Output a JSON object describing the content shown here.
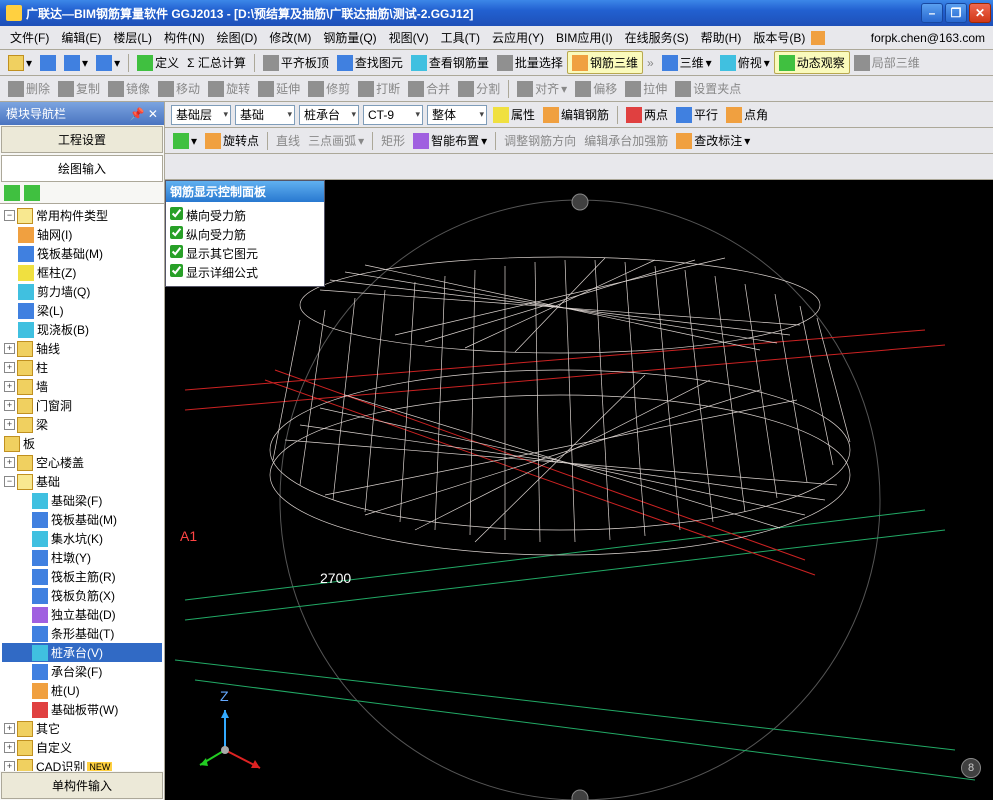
{
  "title": "广联达—BIM钢筋算量软件 GGJ2013 - [D:\\预结算及抽筋\\广联达抽筋\\测试-2.GGJ12]",
  "winbtns": {
    "min": "–",
    "max": "❐",
    "close": "✕"
  },
  "menu": [
    "文件(F)",
    "编辑(E)",
    "楼层(L)",
    "构件(N)",
    "绘图(D)",
    "修改(M)",
    "钢筋量(Q)",
    "视图(V)",
    "工具(T)",
    "云应用(Y)",
    "BIM应用(I)",
    "在线服务(S)",
    "帮助(H)",
    "版本号(B)"
  ],
  "email": "forpk.chen@163.com",
  "tb1": {
    "def": "定义",
    "sum": "Σ 汇总计算",
    "flat": "平齐板顶",
    "find": "查找图元",
    "view": "查看钢筋量",
    "batch": "批量选择",
    "rebar3d": "钢筋三维",
    "sw": "三维",
    "persp": "俯视",
    "dyn": "动态观察",
    "local": "局部三维"
  },
  "tb2": {
    "del": "删除",
    "copy": "复制",
    "mir": "镜像",
    "mov": "移动",
    "rot": "旋转",
    "ext": "延伸",
    "trim": "修剪",
    "brk": "打断",
    "mrg": "合并",
    "spl": "分割",
    "ali": "对齐",
    "off": "偏移",
    "str": "拉伸",
    "grip": "设置夹点"
  },
  "tb3": {
    "floor": "基础层",
    "fam": "基础",
    "type": "桩承台",
    "code": "CT-9",
    "whole": "整体",
    "attr": "属性",
    "editrebar": "编辑钢筋"
  },
  "tb4": {
    "pt2": "两点",
    "para": "平行",
    "ang": "点角",
    "rotpt": "旋转点",
    "line": "直线",
    "arc3": "三点画弧",
    "rect": "矩形",
    "smart": "智能布置",
    "adjust": "调整钢筋方向",
    "editpc": "编辑承台加强筋",
    "note": "查改标注"
  },
  "side": {
    "title": "模块导航栏",
    "tab1": "工程设置",
    "tab2": "绘图输入",
    "tree": {
      "n1": "常用构件类型",
      "n1a": "轴网(I)",
      "n1b": "筏板基础(M)",
      "n1c": "框柱(Z)",
      "n1d": "剪力墙(Q)",
      "n1e": "梁(L)",
      "n1f": "现浇板(B)",
      "n2": "轴线",
      "n3": "柱",
      "n4": "墙",
      "n5": "门窗洞",
      "n6": "梁",
      "n7": "板",
      "n8": "空心楼盖",
      "n9": "基础",
      "n9a": "基础梁(F)",
      "n9b": "筏板基础(M)",
      "n9c": "集水坑(K)",
      "n9d": "柱墩(Y)",
      "n9e": "筏板主筋(R)",
      "n9f": "筏板负筋(X)",
      "n9g": "独立基础(D)",
      "n9h": "条形基础(T)",
      "n9i": "桩承台(V)",
      "n9j": "承台梁(F)",
      "n9k": "桩(U)",
      "n9l": "基础板带(W)",
      "n10": "其它",
      "n11": "自定义",
      "n12": "CAD识别"
    },
    "foot": "单构件输入"
  },
  "panel": {
    "title": "钢筋显示控制面板",
    "c1": "横向受力筋",
    "c2": "纵向受力筋",
    "c3": "显示其它图元",
    "c4": "显示详细公式"
  },
  "canvas": {
    "a1": "A1",
    "dim": "2700",
    "marker": "8",
    "z": "Z"
  }
}
